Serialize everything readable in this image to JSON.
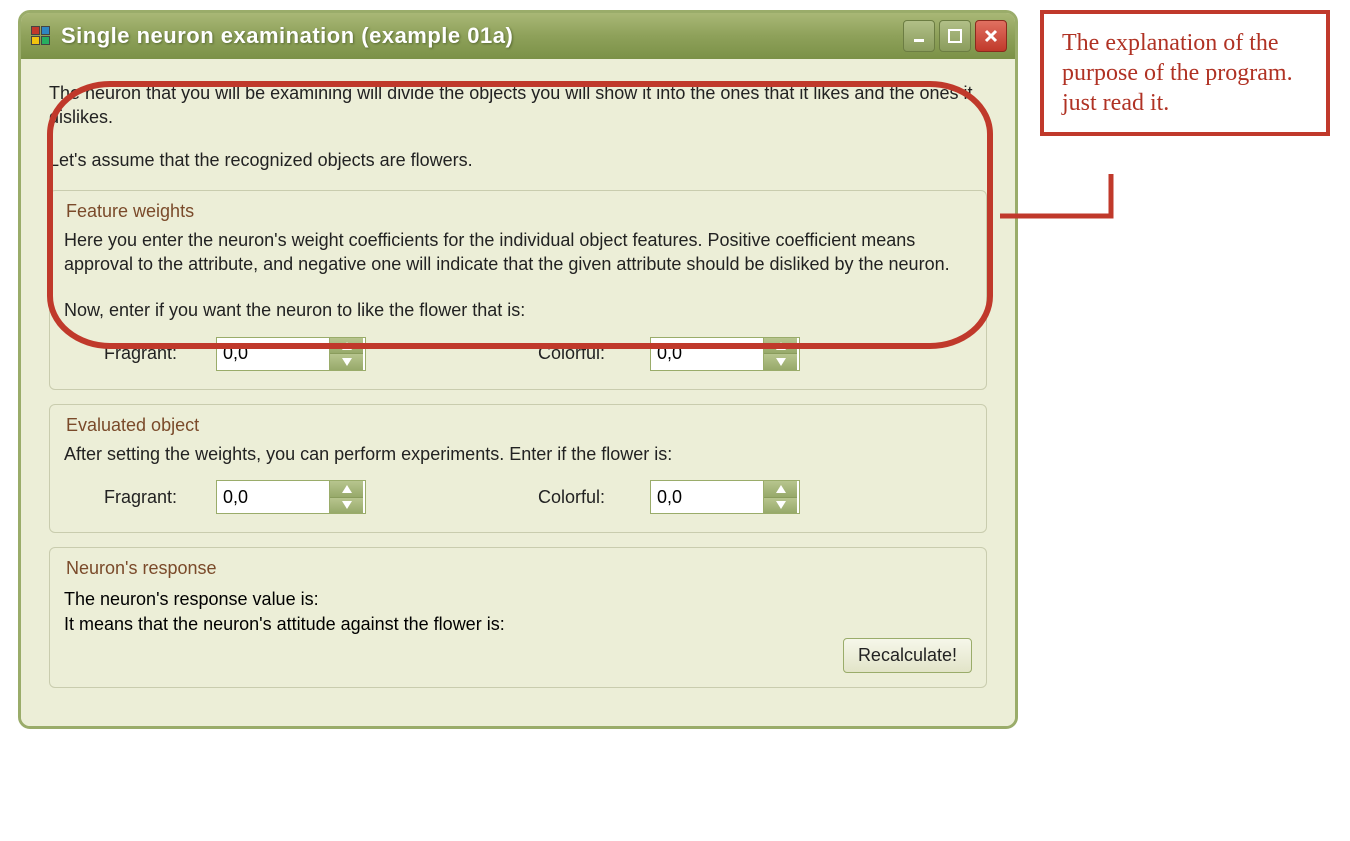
{
  "window": {
    "title": "Single neuron examination (example 01a)"
  },
  "intro": {
    "p1": "The neuron that you will be examining will divide the objects you will show it into the ones that it likes and the ones it dislikes.",
    "p2": "Let's assume that the recognized objects are flowers."
  },
  "feature_weights": {
    "legend": "Feature weights",
    "desc": "Here you enter the neuron's weight coefficients for the individual object features. Positive coefficient means approval to the attribute, and negative one will indicate that the given attribute should be disliked by the neuron.",
    "prompt": "Now, enter if you want the neuron to like the flower that is:",
    "fragrant_label": "Fragrant:",
    "fragrant_value": "0,0",
    "colorful_label": "Colorful:",
    "colorful_value": "0,0"
  },
  "evaluated_object": {
    "legend": "Evaluated object",
    "desc": "After setting the weights, you can perform experiments. Enter if the flower is:",
    "fragrant_label": "Fragrant:",
    "fragrant_value": "0,0",
    "colorful_label": "Colorful:",
    "colorful_value": "0,0"
  },
  "neuron_response": {
    "legend": "Neuron's response",
    "line1": "The neuron's response value is:",
    "line2": "It means that the neuron's attitude against the flower is:",
    "button": "Recalculate!"
  },
  "callout": {
    "text": "The explanation of the purpose of the program. just read it."
  }
}
